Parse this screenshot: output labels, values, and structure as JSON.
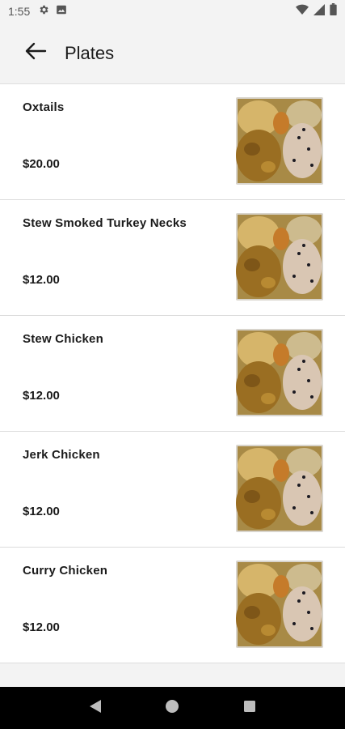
{
  "status_bar": {
    "time": "1:55",
    "icons": [
      "gear-icon",
      "image-icon",
      "wifi-icon",
      "signal-icon",
      "battery-icon"
    ]
  },
  "app_bar": {
    "title": "Plates",
    "back_icon": "arrow-left-icon"
  },
  "items": [
    {
      "name": "Oxtails",
      "price": "$20.00"
    },
    {
      "name": "Stew Smoked Turkey Necks",
      "price": "$12.00"
    },
    {
      "name": "Stew Chicken",
      "price": "$12.00"
    },
    {
      "name": "Jerk Chicken",
      "price": "$12.00"
    },
    {
      "name": "Curry Chicken",
      "price": "$12.00"
    }
  ],
  "nav_bar": {
    "icons": [
      "back-triangle-icon",
      "home-circle-icon",
      "recents-square-icon"
    ]
  },
  "colors": {
    "background": "#f3f3f3",
    "card": "#ffffff",
    "text": "#1b1b1b",
    "nav": "#000000"
  }
}
